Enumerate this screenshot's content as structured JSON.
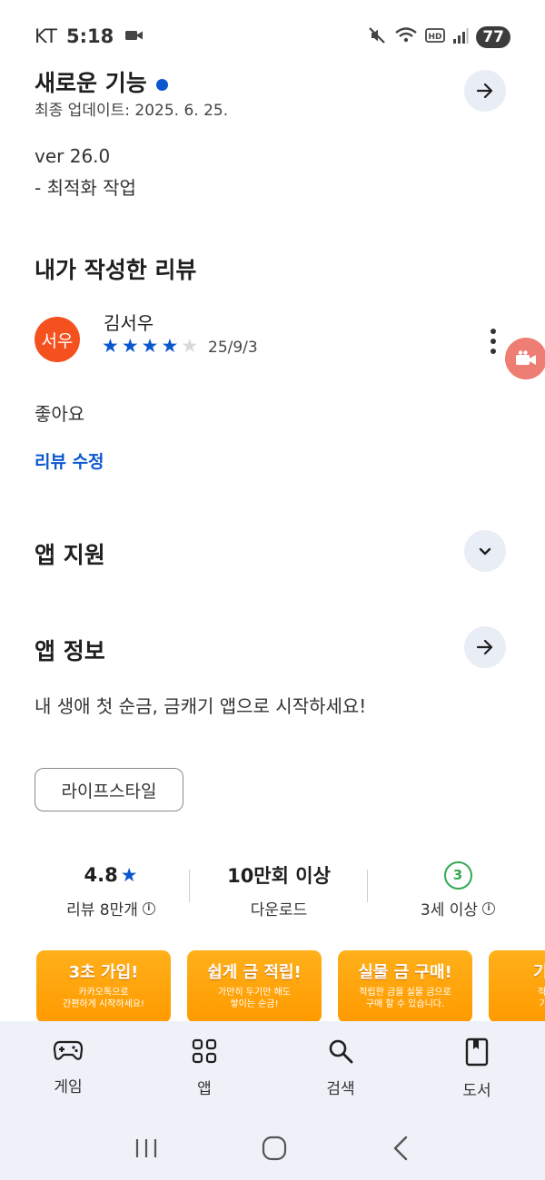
{
  "status_bar": {
    "carrier": "KT",
    "time": "5:18",
    "battery": "77",
    "icons": [
      "video-camera-icon",
      "mute-icon",
      "wifi-icon",
      "hd-icon",
      "signal-icon",
      "battery-icon"
    ]
  },
  "whats_new": {
    "title": "새로운 기능",
    "updated": "최종 업데이트: 2025. 6. 25.",
    "version": "ver 26.0",
    "notes": "- 최적화 작업"
  },
  "my_review": {
    "heading": "내가 작성한 리뷰",
    "avatar_text": "서우",
    "reviewer": "김서우",
    "rating": 4,
    "max_rating": 5,
    "date": "25/9/3",
    "text": "좋아요",
    "edit_link": "리뷰 수정"
  },
  "app_support": {
    "heading": "앱 지원"
  },
  "app_info": {
    "heading": "앱 정보",
    "description": "내 생애 첫 순금, 금캐기 앱으로 시작하세요!",
    "category_chip": "라이프스타일"
  },
  "stats": {
    "rating_value": "4.8",
    "rating_star": "★",
    "rating_label": "리뷰 8만개",
    "downloads_value": "10만회 이상",
    "downloads_label": "다운로드",
    "age_value": "3",
    "age_label": "3세 이상"
  },
  "screenshots": [
    {
      "title": "3초 가입!",
      "sub": "카카오톡으로\n간편하게 시작하세요!"
    },
    {
      "title": "쉽게 금 적립!",
      "sub": "가만히 두기만 해도\n쌓이는 순금!"
    },
    {
      "title": "실물 금 구매!",
      "sub": "적립한 금을 실물 금으로\n구매 할 수 있습니다."
    },
    {
      "title": "기프티",
      "sub": "적립한 금\n기프티콘"
    }
  ],
  "bottom_nav": {
    "items": [
      {
        "label": "게임",
        "icon": "gamepad-icon"
      },
      {
        "label": "앱",
        "icon": "apps-grid-icon"
      },
      {
        "label": "검색",
        "icon": "search-icon"
      },
      {
        "label": "도서",
        "icon": "book-icon"
      }
    ]
  },
  "colors": {
    "accent": "#0b57d0",
    "avatar_bg": "#f4511e",
    "age_badge": "#34a853",
    "nav_bg": "#eef1f8",
    "screenshot_bg": "#ffa500"
  }
}
